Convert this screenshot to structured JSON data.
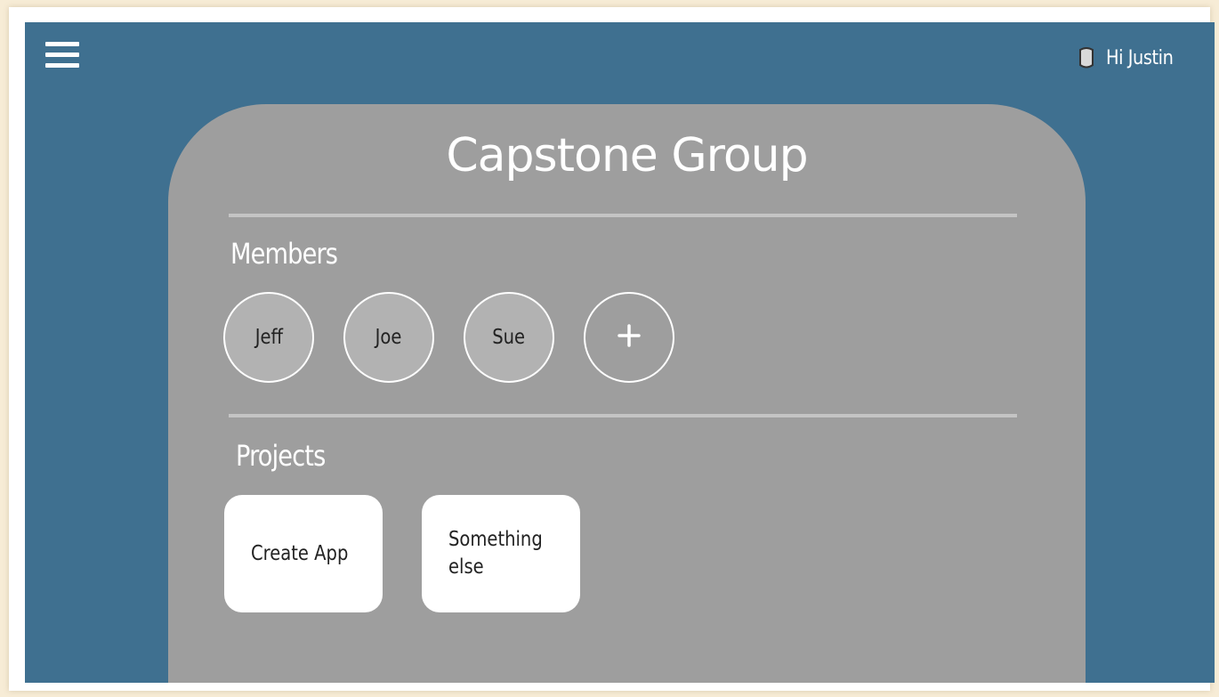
{
  "header": {
    "greeting": "Hi Justin"
  },
  "group": {
    "title": "Capstone Group"
  },
  "members": {
    "label": "Members",
    "items": [
      "Jeff",
      "Joe",
      "Sue"
    ],
    "add_icon": "plus-icon"
  },
  "projects": {
    "label": "Projects",
    "items": [
      "Create App",
      "Something else"
    ]
  },
  "colors": {
    "background": "#3f7090",
    "card": "#9e9e9e",
    "member_fill": "#b2b2b2",
    "project_fill": "#ffffff"
  }
}
